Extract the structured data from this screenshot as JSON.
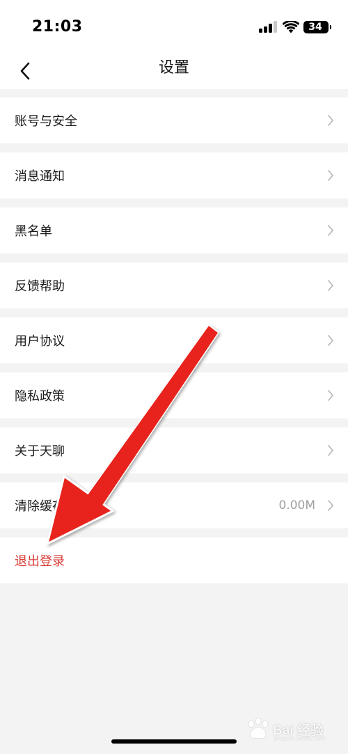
{
  "status_bar": {
    "time": "21:03",
    "battery": "34",
    "icons": [
      "signal-icon",
      "wifi-icon",
      "battery-icon"
    ]
  },
  "nav": {
    "title": "设置",
    "back_icon": "chevron-left-icon"
  },
  "settings": [
    {
      "label": "账号与安全"
    },
    {
      "label": "消息通知"
    },
    {
      "label": "黑名单"
    },
    {
      "label": "反馈帮助"
    },
    {
      "label": "用户协议"
    },
    {
      "label": "隐私政策"
    },
    {
      "label": "关于天聊"
    },
    {
      "label": "清除缓存",
      "value": "0.00M"
    }
  ],
  "logout": {
    "label": "退出登录",
    "color": "#d93a35"
  },
  "annotation": {
    "color": "#e8241c"
  },
  "watermark": {
    "text": "Bai 经验",
    "sub": "jingyan.baidu.com"
  }
}
